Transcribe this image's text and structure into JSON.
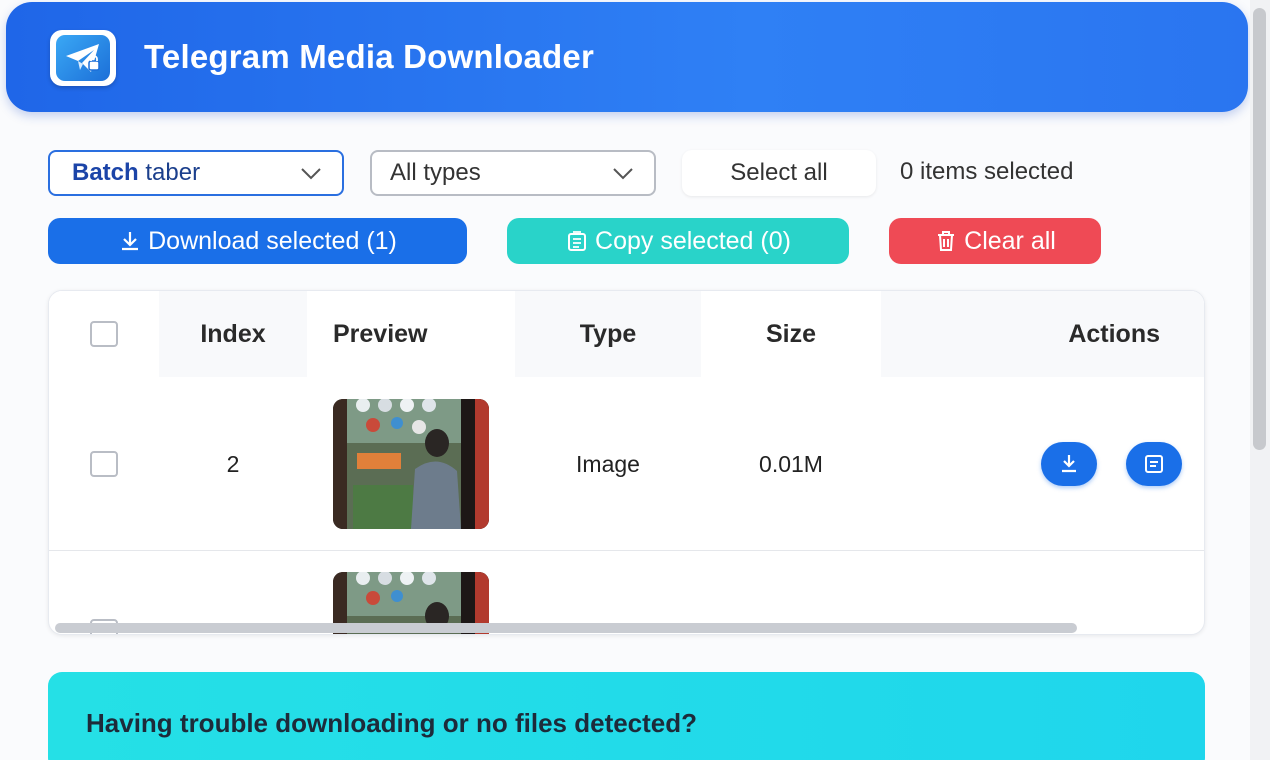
{
  "header": {
    "title": "Telegram Media Downloader",
    "logo_icon": "telegram-paper-plane-icon"
  },
  "filters": {
    "batch_prefix": "Batch",
    "batch_suffix": " taber",
    "type_value": "All types",
    "select_all_label": "Select all",
    "selected_count": "0 items selected"
  },
  "actions": {
    "download_label": "Download selected (1)",
    "copy_label": "Copy selected (0)",
    "clear_label": "Clear all"
  },
  "table": {
    "headers": {
      "index": "Index",
      "preview": "Preview",
      "type": "Type",
      "size": "Size",
      "actions": "Actions"
    },
    "rows": [
      {
        "index": "2",
        "type": "Image",
        "size": "0.01M"
      }
    ]
  },
  "help": {
    "text": "Having trouble downloading or no files detected?"
  },
  "colors": {
    "primary": "#1a6fe8",
    "copy": "#29d3c9",
    "danger": "#ef4a55",
    "help": "#25e0e6"
  }
}
